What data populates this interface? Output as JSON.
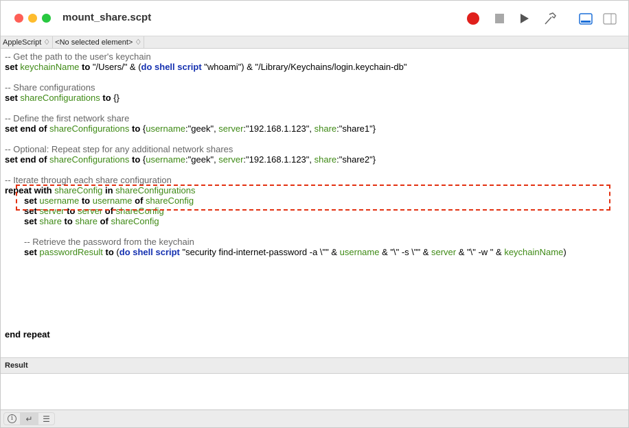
{
  "window": {
    "title": "mount_share.scpt"
  },
  "toolbar": {
    "record": "record-icon",
    "stop": "stop-icon",
    "run": "run-icon",
    "compile": "hammer-icon",
    "view_bottom": "bottom-panel-icon",
    "view_side": "side-panel-icon"
  },
  "nav": {
    "language": "AppleScript ♢",
    "element": "<No selected element> ♢"
  },
  "code": [
    {
      "indent": 0,
      "tokens": [
        {
          "t": "cmt",
          "v": "-- Get the path to the user's keychain"
        }
      ]
    },
    {
      "indent": 0,
      "tokens": [
        {
          "t": "kw",
          "v": "set "
        },
        {
          "t": "var",
          "v": "keychainName"
        },
        {
          "t": "kw",
          "v": " to "
        },
        {
          "t": "txt",
          "v": "\"/Users/\" & ("
        },
        {
          "t": "cmd",
          "v": "do shell script"
        },
        {
          "t": "txt",
          "v": " \"whoami\") & \"/Library/Keychains/login.keychain-db\""
        }
      ]
    },
    {
      "indent": 0,
      "tokens": []
    },
    {
      "indent": 0,
      "tokens": [
        {
          "t": "cmt",
          "v": "-- Share configurations"
        }
      ]
    },
    {
      "indent": 0,
      "tokens": [
        {
          "t": "kw",
          "v": "set "
        },
        {
          "t": "var",
          "v": "shareConfigurations"
        },
        {
          "t": "kw",
          "v": " to "
        },
        {
          "t": "txt",
          "v": "{}"
        }
      ]
    },
    {
      "indent": 0,
      "tokens": []
    },
    {
      "indent": 0,
      "tokens": [
        {
          "t": "cmt",
          "v": "-- Define the first network share"
        }
      ]
    },
    {
      "indent": 0,
      "tokens": [
        {
          "t": "kw",
          "v": "set end of "
        },
        {
          "t": "var",
          "v": "shareConfigurations"
        },
        {
          "t": "kw",
          "v": " to "
        },
        {
          "t": "txt",
          "v": "{"
        },
        {
          "t": "var",
          "v": "username"
        },
        {
          "t": "txt",
          "v": ":\"geek\", "
        },
        {
          "t": "var",
          "v": "server"
        },
        {
          "t": "txt",
          "v": ":\"192.168.1.123\", "
        },
        {
          "t": "var",
          "v": "share"
        },
        {
          "t": "txt",
          "v": ":\"share1\"}"
        }
      ]
    },
    {
      "indent": 0,
      "tokens": []
    },
    {
      "indent": 0,
      "tokens": [
        {
          "t": "cmt",
          "v": "-- Optional: Repeat step for any additional network shares"
        }
      ]
    },
    {
      "indent": 0,
      "tokens": [
        {
          "t": "kw",
          "v": "set end of "
        },
        {
          "t": "var",
          "v": "shareConfigurations"
        },
        {
          "t": "kw",
          "v": " to "
        },
        {
          "t": "txt",
          "v": "{"
        },
        {
          "t": "var",
          "v": "username"
        },
        {
          "t": "txt",
          "v": ":\"geek\", "
        },
        {
          "t": "var",
          "v": "server"
        },
        {
          "t": "txt",
          "v": ":\"192.168.1.123\", "
        },
        {
          "t": "var",
          "v": "share"
        },
        {
          "t": "txt",
          "v": ":\"share2\"}"
        }
      ]
    },
    {
      "indent": 0,
      "tokens": []
    },
    {
      "indent": 0,
      "tokens": [
        {
          "t": "cmt",
          "v": "-- Iterate through each share configuration"
        }
      ]
    },
    {
      "indent": 0,
      "tokens": [
        {
          "t": "kw",
          "v": "repeat with "
        },
        {
          "t": "var",
          "v": "shareConfig"
        },
        {
          "t": "kw",
          "v": " in "
        },
        {
          "t": "var",
          "v": "shareConfigurations"
        }
      ]
    },
    {
      "indent": 1,
      "tokens": [
        {
          "t": "kw",
          "v": "set "
        },
        {
          "t": "var",
          "v": "username"
        },
        {
          "t": "kw",
          "v": " to "
        },
        {
          "t": "var",
          "v": "username"
        },
        {
          "t": "kw",
          "v": " of "
        },
        {
          "t": "var",
          "v": "shareConfig"
        }
      ]
    },
    {
      "indent": 1,
      "tokens": [
        {
          "t": "kw",
          "v": "set "
        },
        {
          "t": "var",
          "v": "server"
        },
        {
          "t": "kw",
          "v": " to "
        },
        {
          "t": "var",
          "v": "server"
        },
        {
          "t": "kw",
          "v": " of "
        },
        {
          "t": "var",
          "v": "shareConfig"
        }
      ]
    },
    {
      "indent": 1,
      "tokens": [
        {
          "t": "kw",
          "v": "set "
        },
        {
          "t": "var",
          "v": "share"
        },
        {
          "t": "kw",
          "v": " to "
        },
        {
          "t": "var",
          "v": "share"
        },
        {
          "t": "kw",
          "v": " of "
        },
        {
          "t": "var",
          "v": "shareConfig"
        }
      ]
    },
    {
      "indent": 0,
      "tokens": []
    },
    {
      "indent": 1,
      "tokens": [
        {
          "t": "cmt",
          "v": "-- Retrieve the password from the keychain"
        }
      ]
    },
    {
      "indent": 1,
      "tokens": [
        {
          "t": "kw",
          "v": "set "
        },
        {
          "t": "var",
          "v": "passwordResult"
        },
        {
          "t": "kw",
          "v": " to "
        },
        {
          "t": "txt",
          "v": "("
        },
        {
          "t": "cmd",
          "v": "do shell script"
        },
        {
          "t": "txt",
          "v": " \"security find-internet-password -a \\\"\" & "
        },
        {
          "t": "var",
          "v": "username"
        },
        {
          "t": "txt",
          "v": " & \"\\\" -s \\\"\" & "
        },
        {
          "t": "var",
          "v": "server"
        },
        {
          "t": "txt",
          "v": " & \"\\\" -w \" & "
        },
        {
          "t": "var",
          "v": "keychainName"
        },
        {
          "t": "txt",
          "v": ")"
        }
      ]
    },
    {
      "indent": 0,
      "tokens": []
    },
    {
      "indent": 0,
      "tokens": []
    },
    {
      "indent": 0,
      "tokens": []
    },
    {
      "indent": 0,
      "tokens": []
    },
    {
      "indent": 0,
      "tokens": []
    },
    {
      "indent": 0,
      "tokens": []
    },
    {
      "indent": 0,
      "tokens": []
    },
    {
      "indent": 0,
      "tokens": [
        {
          "t": "kw",
          "v": "end repeat"
        }
      ]
    }
  ],
  "result": {
    "label": "Result",
    "value": ""
  },
  "colors": {
    "keyword": "#000000",
    "variable": "#3f8a16",
    "command": "#1531b0",
    "comment": "#666666",
    "highlight": "#e33010",
    "record": "#e0201c"
  }
}
